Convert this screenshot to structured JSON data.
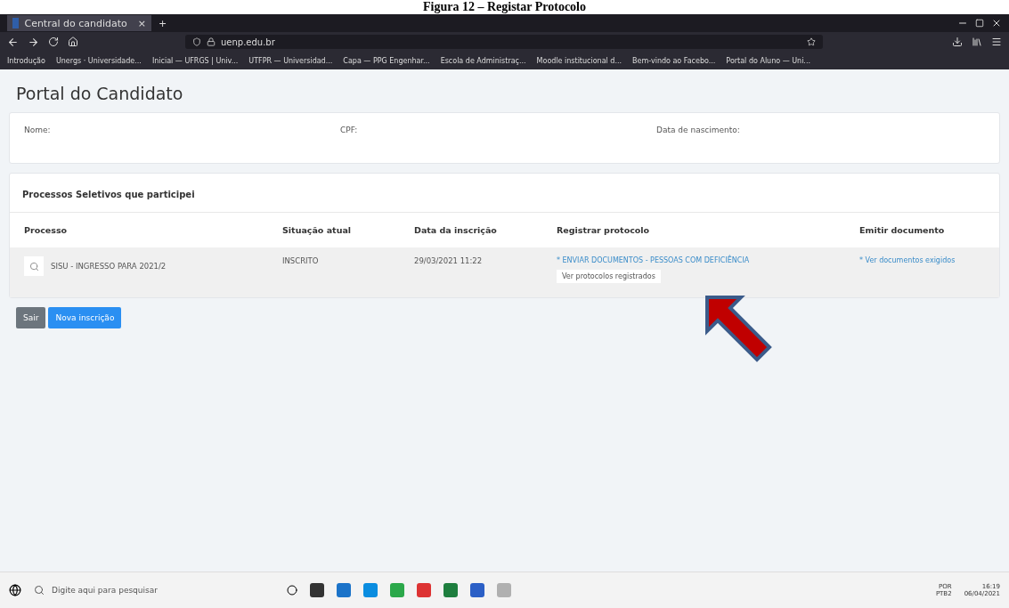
{
  "caption": "Figura 12 – Registar Protocolo",
  "browser": {
    "tab_title": "Central do candidato",
    "tab_close": "×",
    "new_tab": "+",
    "url": "uenp.edu.br",
    "bookmarks": [
      "Introdução",
      "Unergs · Universidade...",
      "Inicial — UFRGS | Univ...",
      "UTFPR — Universidad...",
      "Capa — PPG Engenhar...",
      "Escola de Administraç...",
      "Moodle institucional d...",
      "Bem-vindo ao Facebo...",
      "Portal do Aluno — Uni..."
    ]
  },
  "page": {
    "title": "Portal do Candidato",
    "fields": [
      {
        "label": "Nome:"
      },
      {
        "label": "CPF:"
      },
      {
        "label": "Data de nascimento:"
      }
    ],
    "section_title": "Processos Seletivos que participei",
    "table": {
      "columns": [
        "Processo",
        "Situação atual",
        "Data da inscrição",
        "Registrar protocolo",
        "Emitir documento"
      ],
      "rows": [
        {
          "process": "SISU - INGRESSO PARA 2021/2",
          "status": "INSCRITO",
          "date": "29/03/2021 11:22",
          "protocol_link": "* ENVIAR DOCUMENTOS - PESSOAS COM DEFICIÊNCIA",
          "protocol_button": "Ver protocolos registrados",
          "document_link": "* Ver documentos exigidos"
        }
      ]
    },
    "buttons": [
      {
        "label": "Sair",
        "kind": "secondary"
      },
      {
        "label": "Nova inscrição",
        "kind": "primary"
      }
    ]
  },
  "taskbar": {
    "search_placeholder": "Digite aqui para pesquisar",
    "language": "POR",
    "layout": "PTB2",
    "time": "16:19",
    "date": "06/04/2021"
  }
}
